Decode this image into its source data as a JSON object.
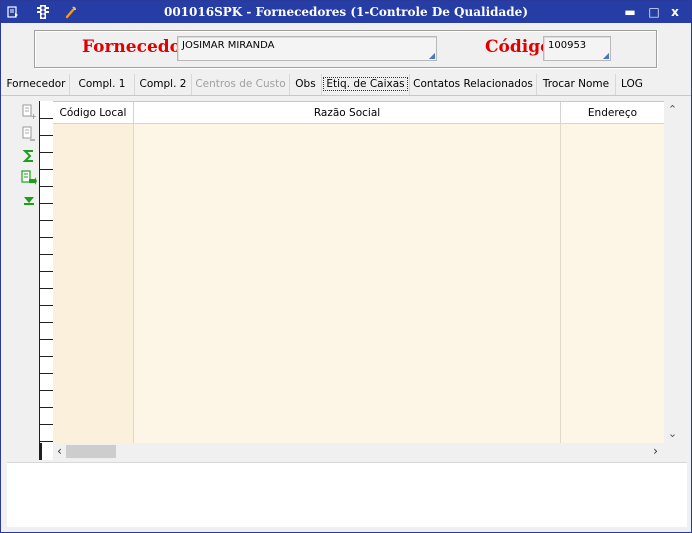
{
  "window": {
    "title": "001016SPK - Fornecedores (1-Controle De Qualidade)",
    "colors": {
      "titlebar": "#263da6",
      "label_red": "#e00000",
      "grid_bg": "#fdf6e6"
    },
    "title_icons": [
      "form-list-icon",
      "traffic-light-icon",
      "wrench-icon"
    ],
    "buttons": {
      "minimize": "▬",
      "maximize": "□",
      "close": "x"
    }
  },
  "header": {
    "supplier_label": "Fornecedor",
    "supplier_value": "JOSIMAR MIRANDA",
    "code_label": "Código",
    "code_value": "100953"
  },
  "tabs": [
    {
      "label": "Fornecedor",
      "state": "normal"
    },
    {
      "label": "Compl. 1",
      "state": "normal"
    },
    {
      "label": "Compl. 2",
      "state": "normal"
    },
    {
      "label": "Centros de Custo",
      "state": "disabled"
    },
    {
      "label": "Obs",
      "state": "normal"
    },
    {
      "label": "Etiq. de Caixas",
      "state": "active"
    },
    {
      "label": "Contatos Relacionados",
      "state": "normal"
    },
    {
      "label": "Trocar Nome",
      "state": "normal"
    },
    {
      "label": "LOG",
      "state": "normal"
    }
  ],
  "side_tools": [
    "insert-row-icon",
    "delete-row-icon",
    "sum-icon",
    "export-icon",
    "filter-icon"
  ],
  "grid": {
    "columns": [
      "Código Local",
      "Razão Social",
      "Endereço"
    ],
    "rows": []
  }
}
